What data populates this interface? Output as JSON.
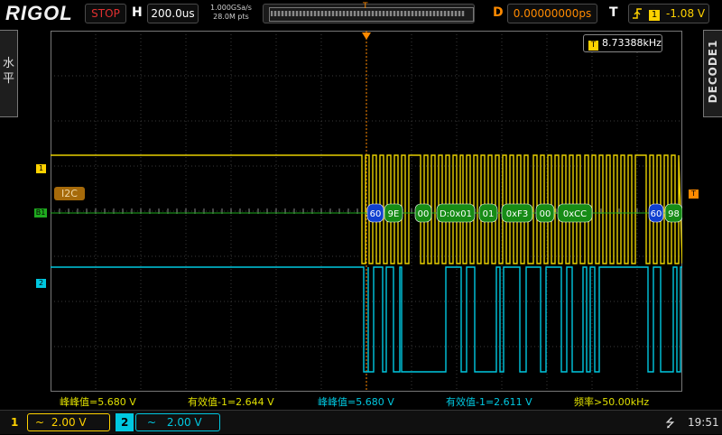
{
  "brand": "RIGOL",
  "status": "STOP",
  "horizontal": {
    "label": "H",
    "timebase": "200.0us",
    "sample_rate": "1.000GSa/s",
    "memory_depth": "28.0M pts",
    "trig_marker": "T"
  },
  "delay": {
    "label": "D",
    "value": "0.00000000ps"
  },
  "trigger": {
    "label": "T",
    "channel": "1",
    "level": "-1.08 V"
  },
  "left_tab": {
    "label": "水平"
  },
  "right_tab": {
    "label": "DECODE1"
  },
  "freq_counter": {
    "icon": "T",
    "value": "8.73388kHz"
  },
  "decode": {
    "tag": "I2C",
    "bus_marker": "B1",
    "packets": [
      "60",
      "9E",
      "00",
      "D:0x01",
      "01",
      "0xF3",
      "00",
      "0xCC",
      "60",
      "98"
    ]
  },
  "markers": {
    "ch1": "1",
    "ch2": "2",
    "trigger_right": "T"
  },
  "measurements": [
    {
      "label": "峰峰值=5.680 V",
      "channel": 1
    },
    {
      "label": "有效值-1=2.644 V",
      "channel": 1
    },
    {
      "label": "峰峰值=5.680 V",
      "channel": 2
    },
    {
      "label": "有效值-1=2.611 V",
      "channel": 2
    },
    {
      "label": "频率>50.00kHz",
      "channel": 1
    }
  ],
  "channels": [
    {
      "number": "1",
      "coupling": "~",
      "scale": "2.00 V",
      "color": "#ffd200"
    },
    {
      "number": "2",
      "coupling": "~",
      "scale": "2.00 V",
      "color": "#00c8e0"
    }
  ],
  "time": "19:51",
  "colors": {
    "ch1": "#ffd200",
    "ch2": "#00c8e0",
    "decode": "#1faa1f",
    "grid": "#3a3a3a"
  }
}
